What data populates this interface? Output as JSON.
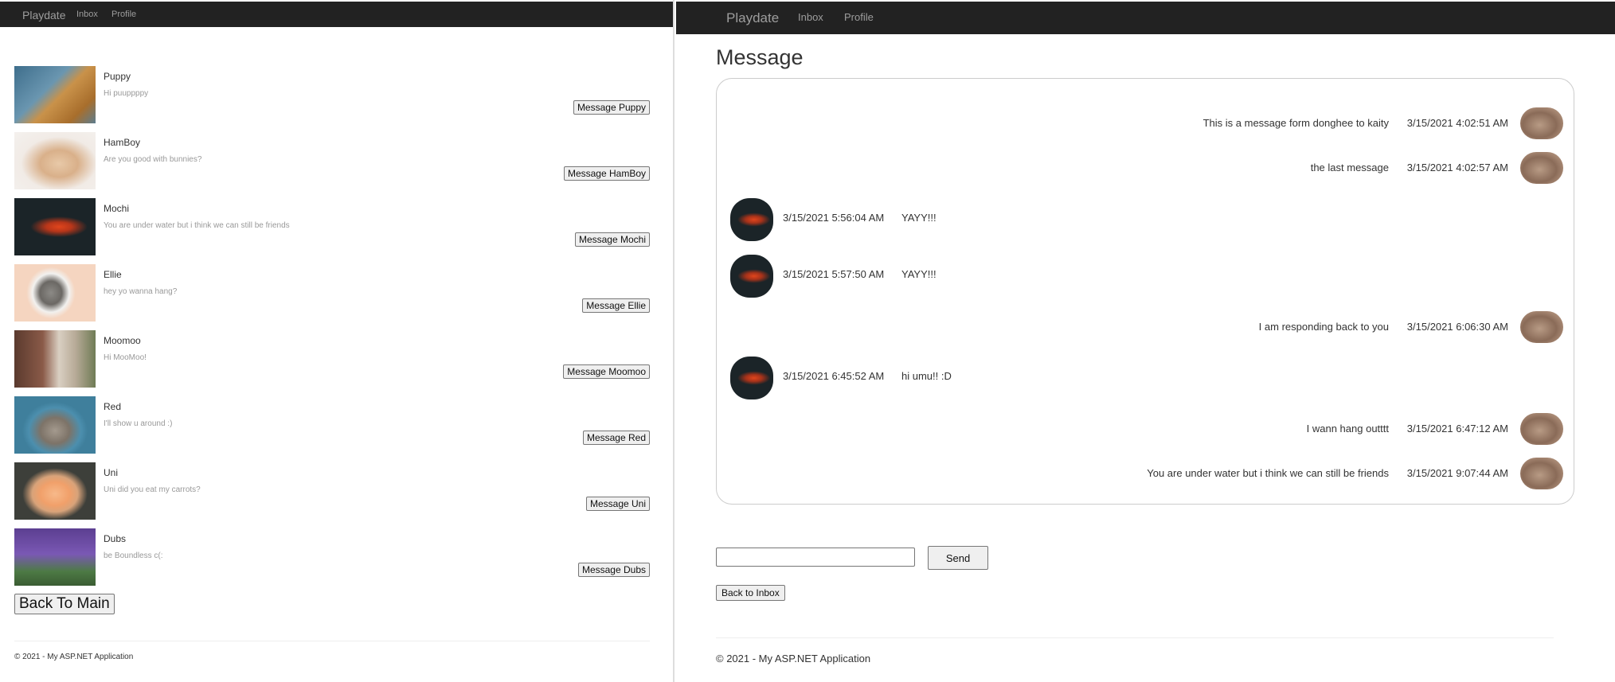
{
  "left": {
    "nav": {
      "brand": "Playdate",
      "inbox": "Inbox",
      "profile": "Profile"
    },
    "friends": [
      {
        "name": "Puppy",
        "message": "Hi puuppppy",
        "button": "Message Puppy",
        "photo": "golden-retriever-photo"
      },
      {
        "name": "HamBoy",
        "message": "Are you good with bunnies?",
        "button": "Message HamBoy",
        "photo": "hamster-photo"
      },
      {
        "name": "Mochi",
        "message": "You are under water but i think we can still be friends",
        "button": "Message Mochi",
        "photo": "goldfish-photo"
      },
      {
        "name": "Ellie",
        "message": "hey yo wanna hang?",
        "button": "Message Ellie",
        "photo": "greyhound-photo"
      },
      {
        "name": "Moomoo",
        "message": "Hi MooMoo!",
        "button": "Message Moomoo",
        "photo": "person-and-pet-photo"
      },
      {
        "name": "Red",
        "message": "I'll show u around :)",
        "button": "Message Red",
        "photo": "tabby-cat-photo"
      },
      {
        "name": "Uni",
        "message": "Uni did you eat my carrots?",
        "button": "Message Uni",
        "photo": "orange-cat-photo"
      },
      {
        "name": "Dubs",
        "message": "be Boundless c(:",
        "button": "Message Dubs",
        "photo": "husky-photo"
      }
    ],
    "back_button": "Back To Main",
    "footer": "© 2021 - My ASP.NET Application"
  },
  "right": {
    "nav": {
      "brand": "Playdate",
      "inbox": "Inbox",
      "profile": "Profile"
    },
    "title": "Message",
    "messages": [
      {
        "side": "mine",
        "text": "This is a message form donghee to kaity",
        "time": "3/15/2021 4:02:51 AM"
      },
      {
        "side": "mine",
        "text": "the last message",
        "time": "3/15/2021 4:02:57 AM"
      },
      {
        "side": "theirs",
        "text": "YAYY!!!",
        "time": "3/15/2021 5:56:04 AM"
      },
      {
        "side": "theirs",
        "text": "YAYY!!!",
        "time": "3/15/2021 5:57:50 AM"
      },
      {
        "side": "mine",
        "text": "I am responding back to you",
        "time": "3/15/2021 6:06:30 AM"
      },
      {
        "side": "theirs",
        "text": "hi umu!! :D",
        "time": "3/15/2021 6:45:52 AM"
      },
      {
        "side": "mine",
        "text": "I wann hang outttt",
        "time": "3/15/2021 6:47:12 AM"
      },
      {
        "side": "mine",
        "text": "You are under water but i think we can still be friends",
        "time": "3/15/2021 9:07:44 AM"
      }
    ],
    "send_input_value": "",
    "send_button": "Send",
    "back_button": "Back to Inbox",
    "footer": "© 2021 - My ASP.NET Application"
  },
  "colors": {
    "navbar": "#222222",
    "nav_text": "#9d9d9d",
    "muted_text": "#999999"
  }
}
